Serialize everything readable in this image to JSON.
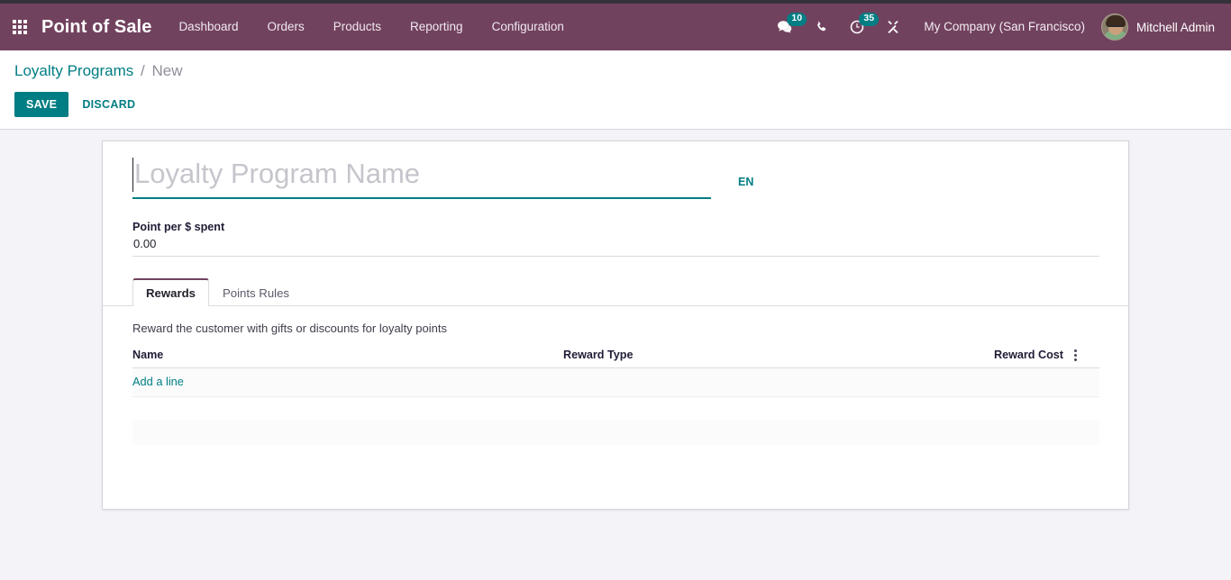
{
  "navbar": {
    "apps_icon": "apps-grid-icon",
    "brand": "Point of Sale",
    "menu": [
      {
        "label": "Dashboard"
      },
      {
        "label": "Orders"
      },
      {
        "label": "Products"
      },
      {
        "label": "Reporting"
      },
      {
        "label": "Configuration"
      }
    ],
    "icons": [
      {
        "name": "messages-icon",
        "badge": "10"
      },
      {
        "name": "phone-icon",
        "badge": ""
      },
      {
        "name": "activities-clock-icon",
        "badge": "35"
      },
      {
        "name": "developer-tools-wrench-icon",
        "badge": ""
      }
    ],
    "company": "My Company (San Francisco)",
    "user": "Mitchell Admin",
    "accent_color": "#71425e",
    "badge_color": "#017e84"
  },
  "control_panel": {
    "breadcrumb_root": "Loyalty Programs",
    "breadcrumb_separator": "/",
    "breadcrumb_current": "New",
    "save_label": "SAVE",
    "discard_label": "DISCARD",
    "primary_color": "#017e84"
  },
  "form": {
    "name_field": {
      "value": "",
      "placeholder": "Loyalty Program Name"
    },
    "language_tag": "EN",
    "points_field": {
      "label": "Point per $ spent",
      "value": "0.00"
    }
  },
  "notebook": {
    "tabs": [
      {
        "label": "Rewards",
        "active": true
      },
      {
        "label": "Points Rules",
        "active": false
      }
    ],
    "rewards_pane": {
      "hint": "Reward the customer with gifts or discounts for loyalty points",
      "columns": [
        "Name",
        "Reward Type",
        "Reward Cost"
      ],
      "optional_columns_icon": "kebab-menu-icon",
      "rows": [],
      "add_line_label": "Add a line"
    }
  }
}
